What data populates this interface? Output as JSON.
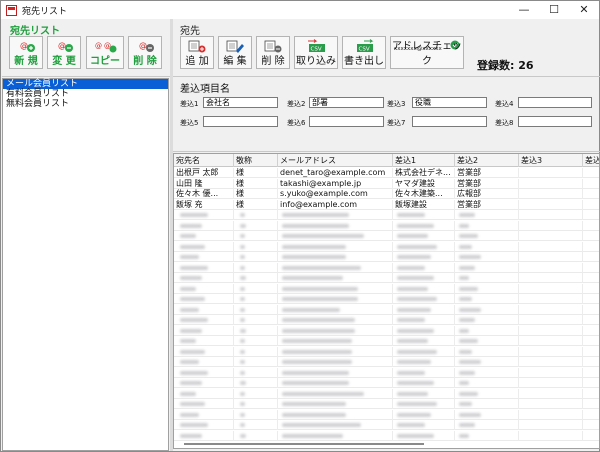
{
  "window": {
    "title": "宛先リスト",
    "minimize": "—",
    "maximize": "☐",
    "close": "✕"
  },
  "left": {
    "section_title": "宛先リスト",
    "buttons": [
      {
        "label": "新 規",
        "icon": "new-list-icon"
      },
      {
        "label": "変 更",
        "icon": "edit-list-icon"
      },
      {
        "label": "コピー",
        "icon": "copy-list-icon"
      },
      {
        "label": "削 除",
        "icon": "delete-list-icon"
      }
    ],
    "lists": [
      "メール会員リスト",
      "有料会員リスト",
      "無料会員リスト"
    ],
    "selected_index": 0
  },
  "right": {
    "section_title": "宛先",
    "buttons": [
      {
        "label": "追 加",
        "icon": "add-recipient-icon"
      },
      {
        "label": "編 集",
        "icon": "edit-recipient-icon"
      },
      {
        "label": "削 除",
        "icon": "delete-recipient-icon"
      },
      {
        "label": "取り込み",
        "icon": "import-csv-icon",
        "badge": "CSV"
      },
      {
        "label": "書き出し",
        "icon": "export-csv-icon",
        "badge": "CSV"
      },
      {
        "label": "アドレスチェック",
        "icon": "address-check-icon",
        "badge": "xxxxxxx@xxxxxx"
      }
    ],
    "count_label": "登録数: 26"
  },
  "fields": {
    "title": "差込項目名",
    "items": [
      {
        "label": "差込1",
        "value": "会社名"
      },
      {
        "label": "差込2",
        "value": "部署"
      },
      {
        "label": "差込3",
        "value": "役職"
      },
      {
        "label": "差込4",
        "value": ""
      },
      {
        "label": "差込5",
        "value": ""
      },
      {
        "label": "差込6",
        "value": ""
      },
      {
        "label": "差込7",
        "value": ""
      },
      {
        "label": "差込8",
        "value": ""
      }
    ]
  },
  "grid": {
    "columns": [
      "宛先名",
      "敬称",
      "メールアドレス",
      "差込1",
      "差込2",
      "差込3",
      "差込"
    ],
    "rows": [
      [
        "出根戸 太郎",
        "様",
        "denet_taro@example.com",
        "株式会社デネ...",
        "営業部",
        "",
        ""
      ],
      [
        "山田 隆",
        "様",
        "takashi@example.jp",
        "ヤマダ建設",
        "営業部",
        "",
        ""
      ],
      [
        "佐々木 優...",
        "様",
        "s.yuko@example.com",
        "佐々木建築...",
        "広報部",
        "",
        ""
      ],
      [
        "飯塚 充",
        "様",
        "info@example.com",
        "飯塚建設",
        "営業部",
        "",
        ""
      ]
    ],
    "blurred_row_count": 22
  },
  "colors": {
    "accent_green": "#1e9e3c",
    "selection_blue": "#0a5fd6",
    "badge_green": "#2a9d4a",
    "plus_green": "#2aa84a",
    "minus_gray": "#666666",
    "delete_red": "#d83030"
  }
}
